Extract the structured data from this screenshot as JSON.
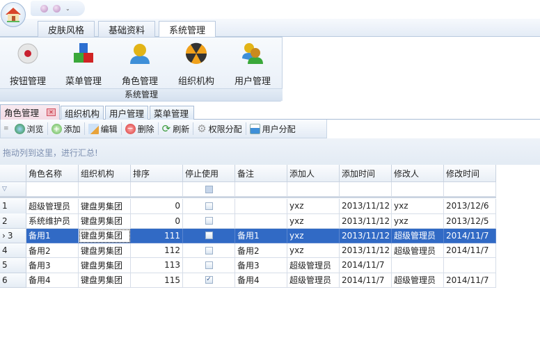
{
  "ribbon_tabs": [
    "皮肤风格",
    "基础资料",
    "系统管理"
  ],
  "ribbon_buttons": [
    "按钮管理",
    "菜单管理",
    "角色管理",
    "组织机构",
    "用户管理"
  ],
  "ribbon_group_label": "系统管理",
  "doc_tabs": [
    "角色管理",
    "组织机构",
    "用户管理",
    "菜单管理"
  ],
  "toolbar": [
    "浏览",
    "添加",
    "编辑",
    "删除",
    "刷新",
    "权限分配",
    "用户分配"
  ],
  "group_hint": "拖动列到这里，进行汇总!",
  "columns": [
    "角色名称",
    "组织机构",
    "排序",
    "停止使用",
    "备注",
    "添加人",
    "添加时间",
    "修改人",
    "修改时间"
  ],
  "rows": [
    {
      "n": "1",
      "name": "超级管理员",
      "org": "键盘男集团",
      "sort": "0",
      "stop": false,
      "note": "",
      "adder": "yxz",
      "addtime": "2013/11/12",
      "mod": "yxz",
      "modtime": "2013/12/6"
    },
    {
      "n": "2",
      "name": "系统维护员",
      "org": "键盘男集团",
      "sort": "0",
      "stop": false,
      "note": "",
      "adder": "yxz",
      "addtime": "2013/11/12",
      "mod": "yxz",
      "modtime": "2013/12/5"
    },
    {
      "n": "3",
      "name": "备用1",
      "org": "键盘男集团",
      "sort": "111",
      "stop": false,
      "note": "备用1",
      "adder": "yxz",
      "addtime": "2013/11/12",
      "mod": "超级管理员",
      "modtime": "2014/11/7",
      "selected": true
    },
    {
      "n": "4",
      "name": "备用2",
      "org": "键盘男集团",
      "sort": "112",
      "stop": false,
      "note": "备用2",
      "adder": "yxz",
      "addtime": "2013/11/12",
      "mod": "超级管理员",
      "modtime": "2014/11/7"
    },
    {
      "n": "5",
      "name": "备用3",
      "org": "键盘男集团",
      "sort": "113",
      "stop": false,
      "note": "备用3",
      "adder": "超级管理员",
      "addtime": "2014/11/7",
      "mod": "",
      "modtime": ""
    },
    {
      "n": "6",
      "name": "备用4",
      "org": "键盘男集团",
      "sort": "115",
      "stop": true,
      "note": "备用4",
      "adder": "超级管理员",
      "addtime": "2014/11/7",
      "mod": "超级管理员",
      "modtime": "2014/11/7"
    }
  ]
}
